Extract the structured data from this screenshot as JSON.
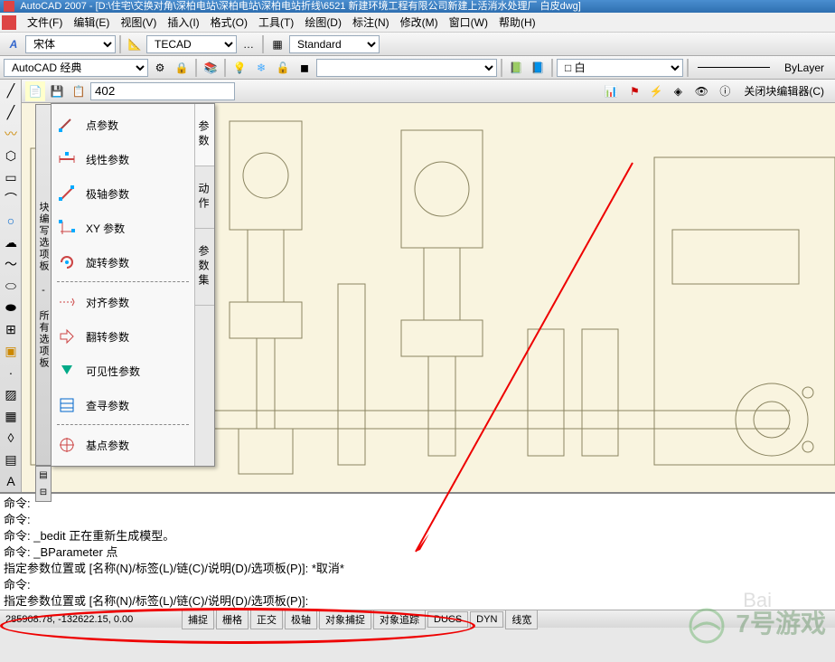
{
  "title": "AutoCAD 2007 - [D:\\住宅\\交换对角\\深柏电站\\深柏电站\\深柏电站折线\\6521 新建环境工程有限公司新建上活消水处理厂 白皮dwg]",
  "menu": {
    "file": "文件(F)",
    "edit": "编辑(E)",
    "view": "视图(V)",
    "insert": "插入(I)",
    "format": "格式(O)",
    "tools": "工具(T)",
    "draw": "绘图(D)",
    "dimension": "标注(N)",
    "modify": "修改(M)",
    "window": "窗口(W)",
    "help": "帮助(H)"
  },
  "toolbar1": {
    "font_name": "宋体",
    "layer_group": "TECAD",
    "text_style": "Standard"
  },
  "toolbar2": {
    "workspace": "AutoCAD 经典",
    "layer_color": "白",
    "bylayer": "ByLayer"
  },
  "block_editor": {
    "block_name": "402",
    "close_label": "关闭块编辑器(C)"
  },
  "palette": {
    "title": "块编写选项板 - 所有选项板",
    "items": [
      {
        "label": "点参数"
      },
      {
        "label": "线性参数"
      },
      {
        "label": "极轴参数"
      },
      {
        "label": "XY 参数"
      },
      {
        "label": "旋转参数"
      },
      {
        "label": "对齐参数"
      },
      {
        "label": "翻转参数"
      },
      {
        "label": "可见性参数"
      },
      {
        "label": "查寻参数"
      },
      {
        "label": "基点参数"
      }
    ],
    "tabs": {
      "params": "参数",
      "actions": "动作",
      "param_sets": "参数集"
    }
  },
  "commandline": {
    "lines": [
      "命令:",
      "命令:",
      "命令: _bedit 正在重新生成模型。",
      "命令: _BParameter 点",
      "指定参数位置或 [名称(N)/标签(L)/链(C)/说明(D)/选项板(P)]: *取消*",
      "命令:",
      "指定参数位置或 [名称(N)/标签(L)/链(C)/说明(D)/选项板(P)]:"
    ]
  },
  "statusbar": {
    "coords": "285908.78, -132622.15, 0.00",
    "buttons": [
      "捕捉",
      "栅格",
      "正交",
      "极轴",
      "对象捕捉",
      "对象追踪",
      "DUCS",
      "DYN",
      "线宽"
    ]
  },
  "watermark": "7号游戏",
  "watermark_sub": "Bai"
}
